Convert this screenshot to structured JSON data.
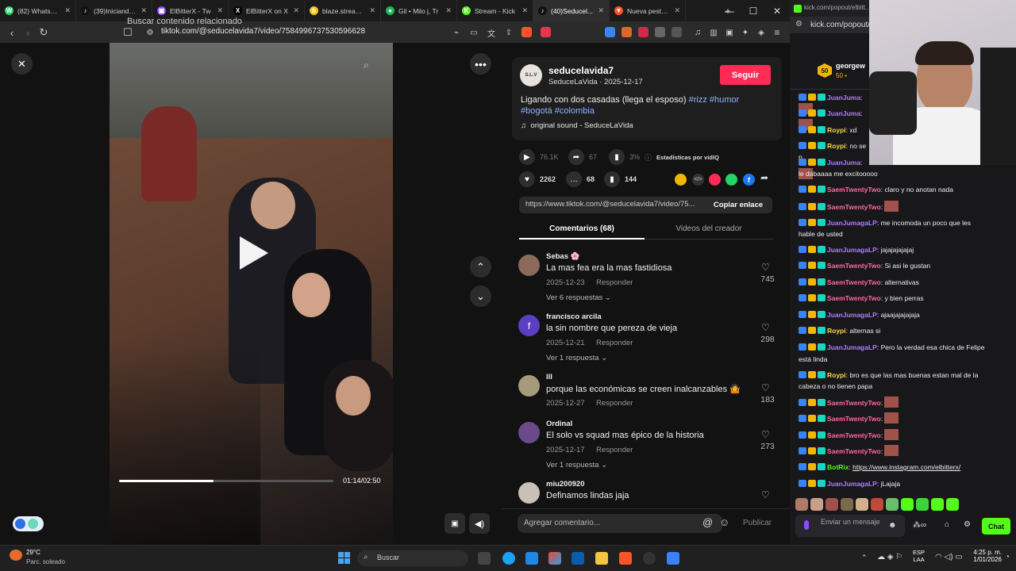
{
  "browser": {
    "tabs": [
      {
        "label": "(82) WhatsApp",
        "color": "#25d366",
        "icon": "whatsapp-icon",
        "glyph": "W"
      },
      {
        "label": "(39)Iniciando mi",
        "color": "#111111",
        "icon": "tiktok-icon",
        "glyph": "♪"
      },
      {
        "label": "ElBitterX - Tw",
        "color": "#9146ff",
        "icon": "twitch-icon",
        "glyph": "▣"
      },
      {
        "label": "ElBitterX on X",
        "color": "#000000",
        "icon": "x-icon",
        "glyph": "X"
      },
      {
        "label": "blaze.stream/stre",
        "color": "#f5c518",
        "icon": "blaze-icon",
        "glyph": "b"
      },
      {
        "label": "Gil • Milo j, Tr",
        "color": "#1db954",
        "icon": "spotify-icon",
        "glyph": "●"
      },
      {
        "label": "Stream - Kick",
        "color": "#53fc18",
        "icon": "kick-icon",
        "glyph": "K"
      },
      {
        "label": "(40)Seducel...",
        "color": "#111111",
        "icon": "tiktok-icon",
        "glyph": "♪"
      },
      {
        "label": "Nueva pestaña",
        "color": "#fb542b",
        "icon": "brave-icon",
        "glyph": "▼"
      }
    ],
    "active_tab": 7,
    "url": "tiktok.com/@seducelavida7/video/7584996737530596628",
    "new_tab": "+",
    "minimize": "—",
    "maximize": "☐",
    "close": "✕"
  },
  "video": {
    "search_placeholder": "Buscar contenido relacionado",
    "time": "01:14/02:50",
    "progress": 0.44
  },
  "post": {
    "username": "seducelavida7",
    "display": "SeduceLaVida · 2025-12-17",
    "avatar_text": "S.L.V",
    "follow_label": "Seguir",
    "caption": "Ligando con dos casadas (llega el esposo) ",
    "tags_line1": "#rizz #humor",
    "tags_line2": "#bogotá #colombia",
    "sound": "original sound - SeduceLaVida",
    "plays": "76.1K",
    "shares_top": "67",
    "percent": "3%",
    "stats_label": "Estadísticas por vidIQ",
    "likes": "2262",
    "comments": "68",
    "saves": "144",
    "link": "https://www.tiktok.com/@seducelavida7/video/75...",
    "copy_label": "Copiar enlace",
    "tab_comments": "Comentarios (68)",
    "tab_creator": "Videos del creador",
    "add_comment_placeholder": "Agregar comentario...",
    "publish": "Publicar"
  },
  "comments": [
    {
      "name": "Sebas 🌸",
      "text": "La mas fea era la mas fastidiosa",
      "date": "2025-12-23",
      "reply": "Responder",
      "more": "Ver 6 respuestas ⌄",
      "likes": "745",
      "avatar_color": "#8a6a5a",
      "initial": ""
    },
    {
      "name": "francisco arcila",
      "text": "la sin nombre que pereza de vieja",
      "date": "2025-12-21",
      "reply": "Responder",
      "more": "Ver 1 respuesta ⌄",
      "likes": "298",
      "avatar_color": "#5b3fc2",
      "initial": "f"
    },
    {
      "name": "lll",
      "text": "porque las económicas se creen inalcanzables 🤷",
      "date": "2025-12-27",
      "reply": "Responder",
      "more": "",
      "likes": "183",
      "avatar_color": "#a59a7a",
      "initial": ""
    },
    {
      "name": "Ordinal",
      "text": "El solo vs squad mas épico de la historia",
      "date": "2025-12-17",
      "reply": "Responder",
      "more": "Ver 1 respuesta ⌄",
      "likes": "273",
      "avatar_color": "#6a4a8a",
      "initial": ""
    },
    {
      "name": "miu200920",
      "text": "Definamos lindas jaja",
      "date": "",
      "reply": "",
      "more": "",
      "likes": "",
      "avatar_color": "#c9c1b8",
      "initial": ""
    }
  ],
  "chat": {
    "url": "kick.com/popout/elbitt...",
    "url2": "kick.com/popout/",
    "top_user": "georgew",
    "top_count": "50",
    "messages": [
      {
        "user": "JuanJuma",
        "color": "#b07cff",
        "text": ""
      },
      {
        "user": "JuanJuma",
        "color": "#b07cff",
        "text": ""
      },
      {
        "user": "Roypi",
        "color": "#ffd54a",
        "text": "xd"
      },
      {
        "user": "Roypi",
        "color": "#ffd54a",
        "text": "no se p"
      },
      {
        "user": "JuanJuma",
        "color": "#b07cff",
        "text": ""
      },
      {
        "user": "",
        "color": "#efeff1",
        "text": "le dabaaaa me excitooooo"
      },
      {
        "user": "SaemTwentyTwo",
        "color": "#ff6b9d",
        "text": "claro y no anotan nada"
      },
      {
        "user": "SaemTwentyTwo",
        "color": "#ff6b9d",
        "text": ""
      },
      {
        "user": "JuanJumagaLP",
        "color": "#b07cff",
        "text": "me incomoda un poco que les"
      },
      {
        "user": "",
        "color": "#efeff1",
        "text": "hable de usted"
      },
      {
        "user": "JuanJumagaLP",
        "color": "#b07cff",
        "text": "jajajajajajaj"
      },
      {
        "user": "SaemTwentyTwo",
        "color": "#ff6b9d",
        "text": "Si asi le gustan"
      },
      {
        "user": "SaemTwentyTwo",
        "color": "#ff6b9d",
        "text": "alternativas"
      },
      {
        "user": "SaemTwentyTwo",
        "color": "#ff6b9d",
        "text": "y bien perras"
      },
      {
        "user": "JuanJumagaLP",
        "color": "#b07cff",
        "text": "ajaajajajajaja"
      },
      {
        "user": "Roypi",
        "color": "#ffd54a",
        "text": "alternas si"
      },
      {
        "user": "JuanJumagaLP",
        "color": "#b07cff",
        "text": "Pero la verdad esa chica de Felipe"
      },
      {
        "user": "",
        "color": "#efeff1",
        "text": "está linda"
      },
      {
        "user": "Roypi",
        "color": "#ffd54a",
        "text": "bro es que las mas buenas estan mal de la"
      },
      {
        "user": "",
        "color": "#efeff1",
        "text": "cabeza o no tienen papa"
      },
      {
        "user": "SaemTwentyTwo",
        "color": "#ff6b9d",
        "text": ""
      },
      {
        "user": "SaemTwentyTwo",
        "color": "#ff6b9d",
        "text": ""
      },
      {
        "user": "SaemTwentyTwo",
        "color": "#ff6b9d",
        "text": ""
      },
      {
        "user": "SaemTwentyTwo",
        "color": "#ff6b9d",
        "text": ""
      },
      {
        "user": "BotRix",
        "color": "#53fc18",
        "text": "https://www.instagram.com/elbitterx/"
      },
      {
        "user": "JuanJumagaLP",
        "color": "#b07cff",
        "text": "jLajaja"
      }
    ],
    "input_placeholder": "Enviar un mensaje",
    "chat_button": "Chat"
  },
  "taskbar": {
    "weather_temp": "29°C",
    "weather_text": "Parc. soleado",
    "search": "Buscar",
    "lang": "ESP",
    "lang2": "LAA",
    "time": "4:25 p. m.",
    "date": "1/01/2026"
  }
}
